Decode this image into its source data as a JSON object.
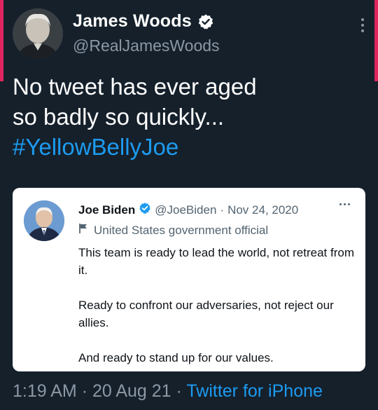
{
  "tweet": {
    "author_name": "James Woods",
    "author_handle": "@RealJamesWoods",
    "text_line1": "No tweet has ever aged",
    "text_line2": "so badly so quickly...",
    "hashtag": "#YellowBellyJoe",
    "time": "1:19 AM",
    "date": "20 Aug 21",
    "source": "Twitter for iPhone",
    "sep": "·"
  },
  "quoted": {
    "author_name": "Joe Biden",
    "author_handle": "@JoeBiden",
    "date": "Nov 24, 2020",
    "sep": "·",
    "label": "United States government official",
    "paragraphs": [
      "This team is ready to lead the world, not retreat from it.",
      "Ready to confront our adversaries, not reject our allies.",
      "And ready to stand up for our values."
    ]
  },
  "colors": {
    "background": "#15202b",
    "accent_link": "#1d9bf0",
    "muted": "#8b98a5",
    "side_bar": "#e0245e"
  },
  "icons": [
    "verified-badge-icon",
    "more-options-icon",
    "flag-label-icon"
  ]
}
